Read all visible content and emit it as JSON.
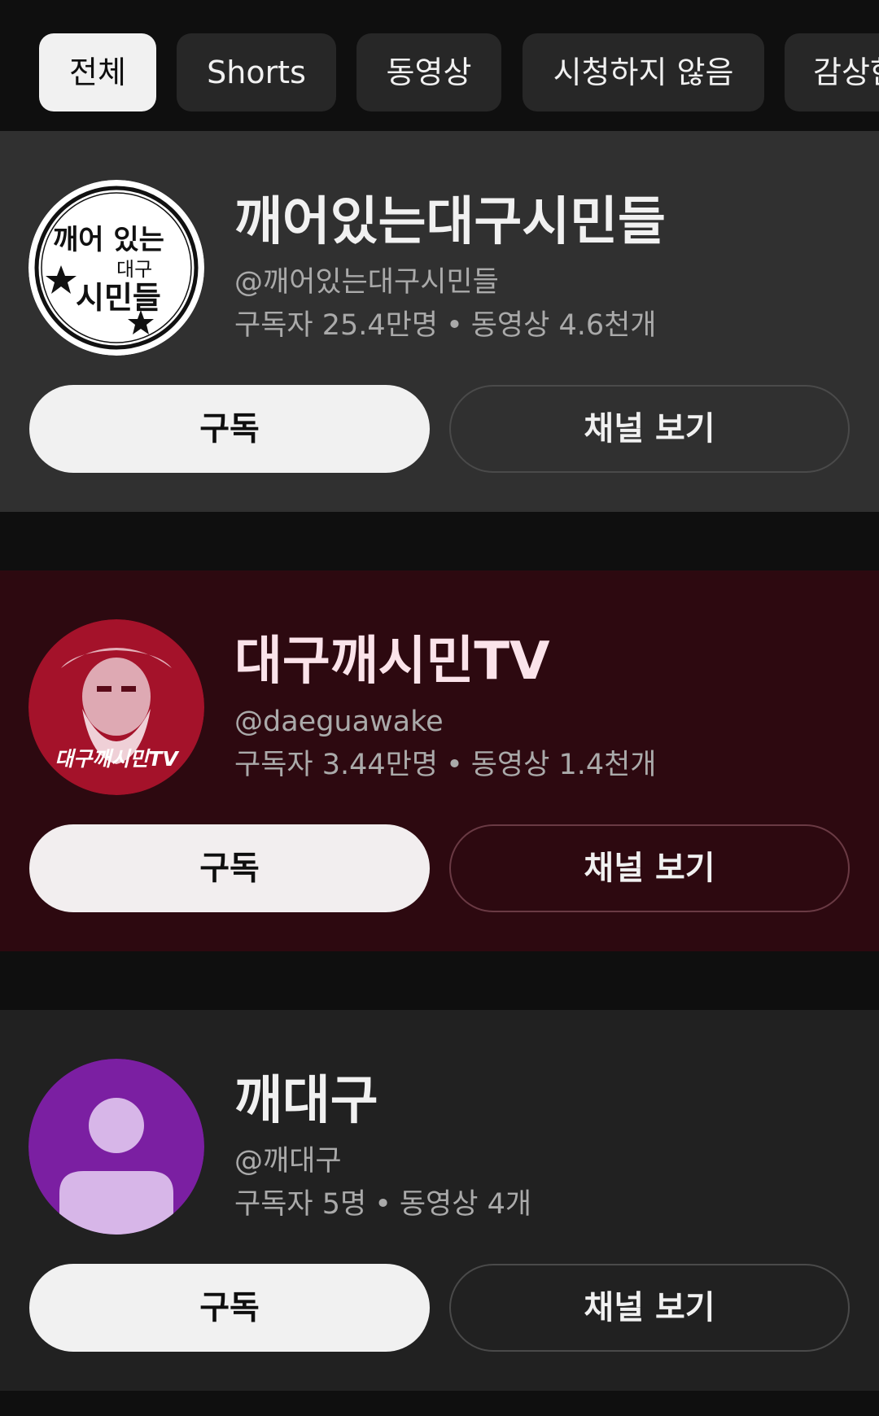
{
  "chips": [
    {
      "label": "전체",
      "active": true
    },
    {
      "label": "Shorts",
      "active": false
    },
    {
      "label": "동영상",
      "active": false
    },
    {
      "label": "시청하지 않음",
      "active": false
    },
    {
      "label": "감상한",
      "active": false
    }
  ],
  "channels": [
    {
      "name": "깨어있는대구시민들",
      "handle": "@깨어있는대구시민들",
      "subscribers": "구독자 25.4만명",
      "videos": "동영상 4.6천개",
      "subscribe_label": "구독",
      "view_label": "채널 보기",
      "avatar_text": [
        "깨어 있는",
        "대구",
        "시민들"
      ]
    },
    {
      "name": "대구깨시민TV",
      "handle": "@daeguawake",
      "subscribers": "구독자 3.44만명",
      "videos": "동영상 1.4천개",
      "subscribe_label": "구독",
      "view_label": "채널 보기",
      "avatar_text": [
        "대구깨시민TV"
      ]
    },
    {
      "name": "깨대구",
      "handle": "@깨대구",
      "subscribers": "구독자 5명",
      "videos": "동영상 4개",
      "subscribe_label": "구독",
      "view_label": "채널 보기"
    }
  ],
  "separator": "•",
  "colors": {
    "background": "#0f0f0f",
    "card1": "#303030",
    "card2": "#2d0910",
    "card3": "#212121",
    "avatar_purple": "#7b1fa2",
    "avatar_person": "#d7b6e8",
    "avatar_red": "#a4122a"
  }
}
